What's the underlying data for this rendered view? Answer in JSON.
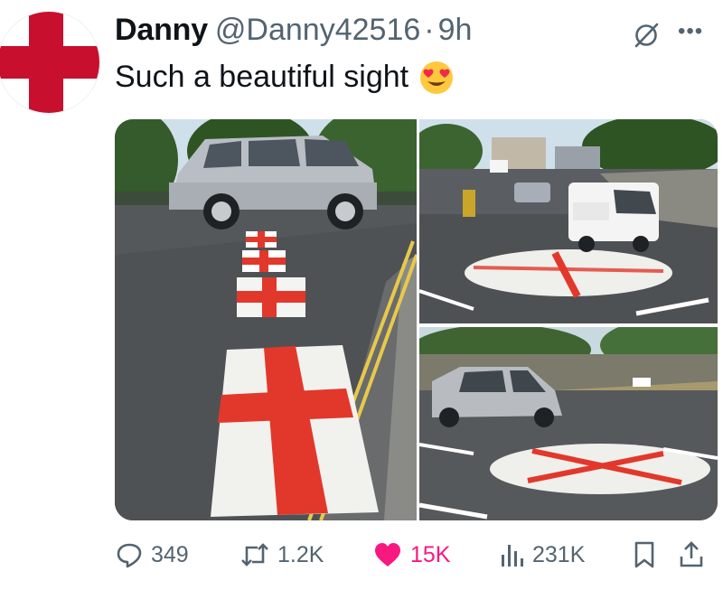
{
  "author": {
    "name": "Danny",
    "handle": "@Danny42516",
    "separator": "·",
    "time": "9h",
    "avatar_colors": {
      "cross": "#c8102e",
      "background": "#ffffff"
    }
  },
  "tweet": {
    "text": "Such a beautiful sight",
    "emoji": "heart-eyes-emoji"
  },
  "media": {
    "count": 3
  },
  "actions": {
    "replies": "349",
    "reposts": "1.2K",
    "likes": "15K",
    "views": "231K"
  },
  "colors": {
    "accent_like": "#f91880",
    "secondary_text": "#536471",
    "primary_text": "#0f1419"
  },
  "icons": [
    "more-icon",
    "grok-icon",
    "reply-icon",
    "retweet-icon",
    "like-icon",
    "views-icon",
    "bookmark-icon",
    "share-icon"
  ]
}
